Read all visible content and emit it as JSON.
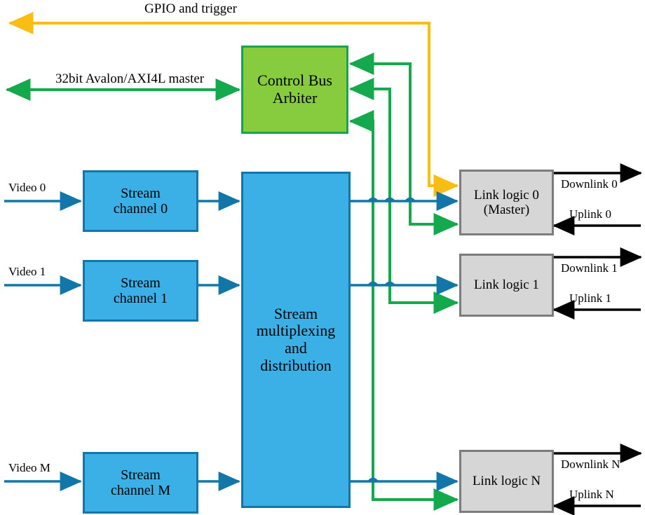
{
  "diagram": {
    "title": "Multi-channel video stream link block diagram",
    "colors": {
      "blue_fill": "#3BB0E6",
      "blue_border": "#1277A8",
      "blue_wire": "#1277A8",
      "green_fill": "#86CC3E",
      "green_border": "#17A44C",
      "green_wire": "#15A94E",
      "gray_fill": "#D6D6D6",
      "gray_border": "#7C7C7C",
      "yellow_wire": "#F9BE16",
      "black_wire": "#000000"
    },
    "blocks": {
      "control_bus_arbiter": {
        "label": "Control Bus\nArbiter"
      },
      "stream_mux": {
        "label": "Stream\nmultiplexing\nand\ndistribution"
      },
      "stream_channels": [
        {
          "label": "Stream\nchannel 0"
        },
        {
          "label": "Stream\nchannel 1"
        },
        {
          "label": "Stream\nchannel M"
        }
      ],
      "link_logic": [
        {
          "label": "Link logic 0\n(Master)"
        },
        {
          "label": "Link logic 1"
        },
        {
          "label": "Link logic N"
        }
      ]
    },
    "wire_labels": {
      "gpio": "GPIO and trigger",
      "control_bus": "32bit Avalon/AXI4L master",
      "video_inputs": [
        "Video 0",
        "Video 1",
        "Video M"
      ],
      "downlinks": [
        "Downlink 0",
        "Downlink 1",
        "Downlink N"
      ],
      "uplinks": [
        "Uplink 0",
        "Uplink 1",
        "Uplink N"
      ]
    }
  }
}
